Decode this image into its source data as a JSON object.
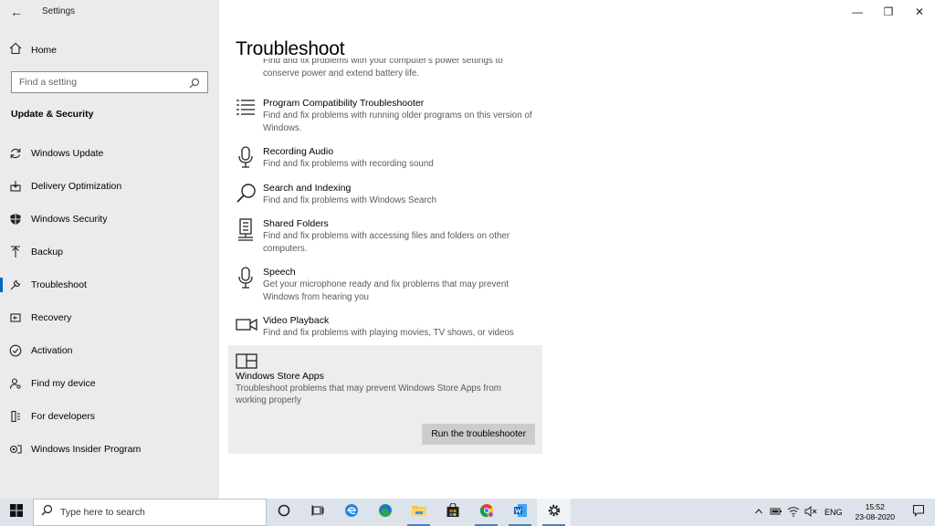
{
  "window": {
    "app_title": "Settings",
    "controls": {
      "minimize": "—",
      "restore": "❐",
      "close": "✕"
    }
  },
  "sidebar": {
    "back_glyph": "←",
    "home_label": "Home",
    "search_placeholder": "Find a setting",
    "section_title": "Update & Security",
    "items": [
      {
        "label": "Windows Update",
        "icon": "sync-icon"
      },
      {
        "label": "Delivery Optimization",
        "icon": "delivery-icon"
      },
      {
        "label": "Windows Security",
        "icon": "shield-icon"
      },
      {
        "label": "Backup",
        "icon": "backup-arrow-icon"
      },
      {
        "label": "Troubleshoot",
        "icon": "wrench-icon",
        "active": true
      },
      {
        "label": "Recovery",
        "icon": "recovery-icon"
      },
      {
        "label": "Activation",
        "icon": "check-circle-icon"
      },
      {
        "label": "Find my device",
        "icon": "person-search-icon"
      },
      {
        "label": "For developers",
        "icon": "developer-icon"
      },
      {
        "label": "Windows Insider Program",
        "icon": "insider-icon"
      }
    ]
  },
  "main": {
    "title": "Troubleshoot",
    "cut_desc": "Find and fix problems with your computer's power settings to conserve power and extend battery life.",
    "troubleshooters": [
      {
        "name": "Program Compatibility Troubleshooter",
        "desc": "Find and fix problems with running older programs on this version of Windows.",
        "icon": "list-icon"
      },
      {
        "name": "Recording Audio",
        "desc": "Find and fix problems with recording sound",
        "icon": "microphone-icon"
      },
      {
        "name": "Search and Indexing",
        "desc": "Find and fix problems with Windows Search",
        "icon": "search-icon"
      },
      {
        "name": "Shared Folders",
        "desc": "Find and fix problems with accessing files and folders on other computers.",
        "icon": "shared-folder-icon"
      },
      {
        "name": "Speech",
        "desc": "Get your microphone ready and fix problems that may prevent Windows from hearing you",
        "icon": "microphone-icon"
      },
      {
        "name": "Video Playback",
        "desc": "Find and fix problems with playing movies, TV shows, or videos",
        "icon": "video-camera-icon"
      },
      {
        "name": "Windows Store Apps",
        "desc": "Troubleshoot problems that may prevent Windows Store Apps from working properly",
        "icon": "store-apps-icon",
        "selected": true
      }
    ],
    "run_button": "Run the troubleshooter"
  },
  "taskbar": {
    "search_placeholder": "Type here to search",
    "apps": [
      "cortana-icon",
      "task-view-icon",
      "edge-legacy-icon",
      "edge-icon",
      "file-explorer-icon",
      "store-icon",
      "chrome-icon",
      "word-icon",
      "settings-icon"
    ],
    "language": "ENG",
    "time": "15:52",
    "date": "23-08-2020"
  },
  "colors": {
    "sidebar_bg": "#ebebeb",
    "accent": "#0067c0",
    "taskbar_bg": "#dde3ea",
    "selected_item_bg": "#ededed",
    "button_bg": "#cccccc"
  }
}
